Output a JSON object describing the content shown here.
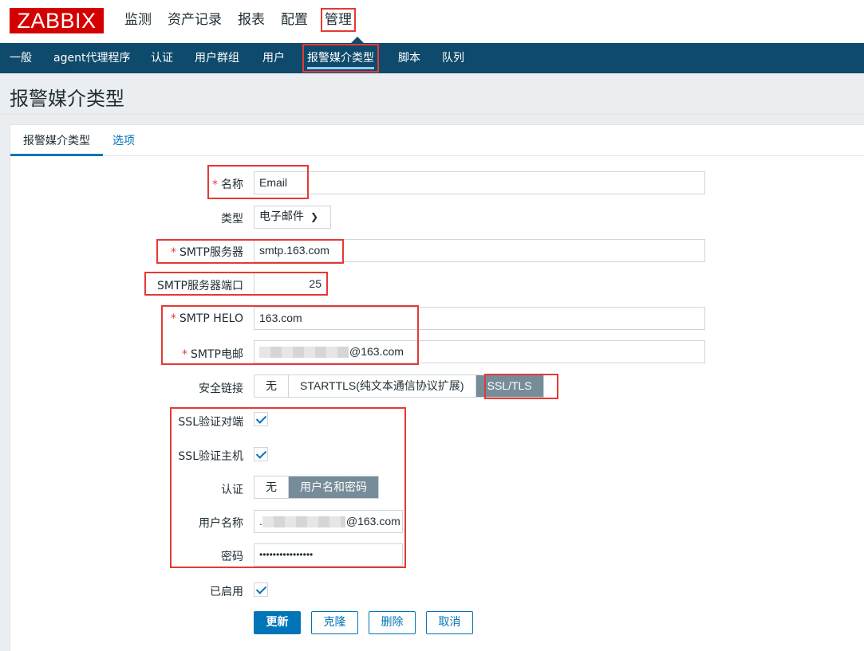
{
  "header": {
    "logo": "ZABBIX",
    "menu": [
      "监测",
      "资产记录",
      "报表",
      "配置",
      "管理"
    ],
    "active_menu": "管理"
  },
  "subnav": {
    "items": [
      "一般",
      "agent代理程序",
      "认证",
      "用户群组",
      "用户",
      "报警媒介类型",
      "脚本",
      "队列"
    ],
    "active": "报警媒介类型"
  },
  "page": {
    "title": "报警媒介类型"
  },
  "tabs": {
    "active": "报警媒介类型",
    "other": "选项"
  },
  "form": {
    "required_mark": "*",
    "name": {
      "label": "名称",
      "value": "Email"
    },
    "type": {
      "label": "类型",
      "value": "电子邮件"
    },
    "smtp_server": {
      "label": "SMTP服务器",
      "value": "smtp.163.com"
    },
    "smtp_port": {
      "label": "SMTP服务器端口",
      "value": "25"
    },
    "smtp_helo": {
      "label": "SMTP HELO",
      "value": "163.com"
    },
    "smtp_email": {
      "label": "SMTP电邮",
      "value_suffix": "@163.com"
    },
    "connection_security": {
      "label": "安全链接",
      "options": [
        "无",
        "STARTTLS(纯文本通信协议扩展)",
        "SSL/TLS"
      ],
      "selected": "SSL/TLS"
    },
    "ssl_verify_peer": {
      "label": "SSL验证对端",
      "checked": true
    },
    "ssl_verify_host": {
      "label": "SSL验证主机",
      "checked": true
    },
    "authentication": {
      "label": "认证",
      "options": [
        "无",
        "用户名和密码"
      ],
      "selected": "用户名和密码"
    },
    "username": {
      "label": "用户名称",
      "value_prefix": ".",
      "value_suffix": "@163.com"
    },
    "password": {
      "label": "密码",
      "value": "••••••••••••••••"
    },
    "enabled": {
      "label": "已启用",
      "checked": true
    }
  },
  "buttons": {
    "update": "更新",
    "clone": "克隆",
    "delete": "删除",
    "cancel": "取消"
  },
  "colors": {
    "accent": "#0275b8",
    "nav_bg": "#0e4a6b",
    "logo_bg": "#d40000",
    "highlight": "#e53935",
    "segment_selected": "#768d99"
  }
}
